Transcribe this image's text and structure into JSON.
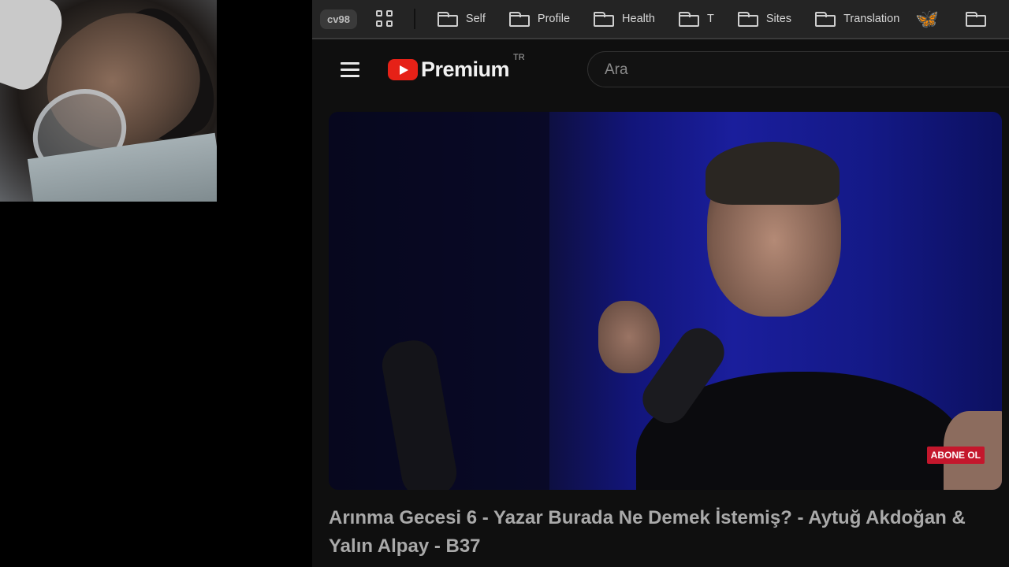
{
  "webcam": {
    "description": "person lying in bed wearing an oxygen mask"
  },
  "bookmarks": {
    "profile": "cv98",
    "items": [
      {
        "label": "Self"
      },
      {
        "label": "Profile"
      },
      {
        "label": "Health"
      },
      {
        "label": "T"
      },
      {
        "label": "Sites"
      },
      {
        "label": "Translation"
      }
    ]
  },
  "youtube": {
    "logo_text": "Premium",
    "region": "TR",
    "search_placeholder": "Ara"
  },
  "video": {
    "badge": "ABONE OL",
    "title": "Arınma Gecesi 6 - Yazar Burada Ne Demek İstemiş? - Aytuğ Akdoğan & Yalın Alpay - B37"
  },
  "colors": {
    "accent_red": "#e62117",
    "bluesky": "#3d8af7",
    "badge_red": "#c4172c"
  }
}
